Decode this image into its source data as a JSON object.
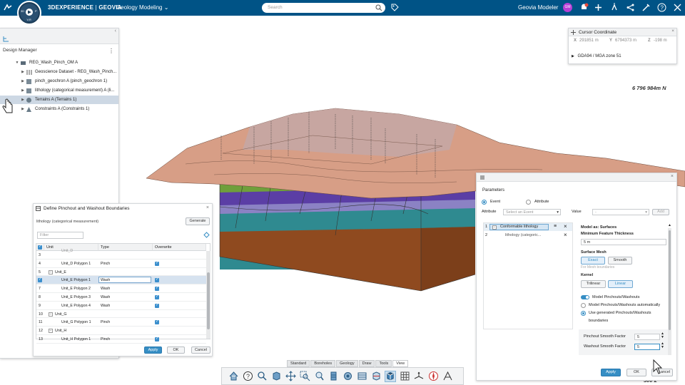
{
  "topbar": {
    "brand": "3DEXPERIENCE",
    "separator": " | ",
    "brand_suffix": "GEOVIA",
    "app_name": "Geology Modeling",
    "search_placeholder": "Search",
    "user_name": "Geovia Modeler",
    "avatar_initials": "GM",
    "compass_version": "V.R",
    "compass_letters": [
      "3D",
      "P"
    ]
  },
  "design_manager": {
    "title": "Design Manager",
    "tree": [
      {
        "label": "REG_Wash_Pinch_OM A",
        "level": 1,
        "expanded": true
      },
      {
        "label": "Geoscience Dataset - REG_Wash_Pinch...",
        "level": 2
      },
      {
        "label": "pinch_geochron A (pinch_geochron 1)",
        "level": 2
      },
      {
        "label": "lithology (categorical measurement) A (li...",
        "level": 2
      },
      {
        "label": "Terrains A (Terrains 1)",
        "level": 2,
        "selected": true
      },
      {
        "label": "Constraints A (Constraints 1)",
        "level": 2
      }
    ]
  },
  "viewport": {
    "coord_north": "6 796 984m N",
    "coord_bottom": "300 2"
  },
  "cursor_coordinate": {
    "title": "Cursor Coordinate",
    "x_label": "X",
    "x_value": "291851 m",
    "y_label": "Y",
    "y_value": "6794373 m",
    "z_label": "Z",
    "z_value": "-198 m",
    "crs": "GDA94 / MGA zone 51"
  },
  "pinchout_dialog": {
    "title": "Define Pinchout and Washout Boundaries",
    "source": "lithology (categorical measurement)",
    "generate_label": "Generate",
    "filter_placeholder": "Filter",
    "columns": [
      "Unit",
      "Type",
      "Overwrite"
    ],
    "rows": [
      {
        "num": "3",
        "unit": "Unit_D",
        "type": "",
        "overwrite": null,
        "group": false
      },
      {
        "num": "4",
        "unit": "Unit_D Polygon 1",
        "type": "Pinch",
        "overwrite": true,
        "group": false
      },
      {
        "num": "5",
        "unit": "Unit_E",
        "type": "",
        "overwrite": null,
        "group": true
      },
      {
        "num": "6",
        "unit": "Unit_E Polygon 1",
        "type": "Wash",
        "overwrite": true,
        "group": false,
        "selected": true,
        "checked": true
      },
      {
        "num": "7",
        "unit": "Unit_E Polygon 2",
        "type": "Wash",
        "overwrite": true,
        "group": false
      },
      {
        "num": "8",
        "unit": "Unit_E Polygon 3",
        "type": "Wash",
        "overwrite": true,
        "group": false
      },
      {
        "num": "9",
        "unit": "Unit_E Polygon 4",
        "type": "Wash",
        "overwrite": true,
        "group": false
      },
      {
        "num": "10",
        "unit": "Unit_G",
        "type": "",
        "overwrite": null,
        "group": true
      },
      {
        "num": "11",
        "unit": "Unit_G Polygon 1",
        "type": "Pinch",
        "overwrite": true,
        "group": false
      },
      {
        "num": "12",
        "unit": "Unit_H",
        "type": "",
        "overwrite": null,
        "group": true
      },
      {
        "num": "13",
        "unit": "Unit_H Polygon 1",
        "type": "Pinch",
        "overwrite": true,
        "group": false
      }
    ],
    "apply_label": "Apply",
    "ok_label": "OK",
    "cancel_label": "Cancel"
  },
  "parameters": {
    "title": "Parameters",
    "option_event": "Event",
    "option_attribute": "Attribute",
    "attribute_label": "Attribute",
    "attribute_placeholder": "Select an Event",
    "value_label": "Value",
    "value_placeholder": "-",
    "add_label": "Add",
    "events": [
      {
        "num": "1",
        "label": "Conformable lithology"
      },
      {
        "num": "2",
        "label": "lithology (categoric..."
      }
    ],
    "model_as": "Model as: Surfaces",
    "min_thickness_label": "Minimum Feature Thickness",
    "min_thickness_value": "5 m",
    "surface_mesh_label": "Surface Mesh",
    "mesh_exact": "Exact",
    "mesh_smooth": "Smooth",
    "mesh_hint": "For Mesh boundaries",
    "kernel_label": "Kernel",
    "kernel_trilinear": "Trilinear",
    "kernel_linear": "Linear",
    "model_pinch": "Model Pinchouts/Washouts",
    "model_pinch_auto": "Model Pinchouts/Washouts automatically",
    "use_generated": "Use generated Pinchouts/Washouts",
    "use_generated_2": "boundaries",
    "pinchout_factor_label": "Pinchout Smooth Factor",
    "pinchout_factor_value": "5",
    "washout_factor_label": "Washout Smooth Factor",
    "washout_factor_value": "5",
    "apply_label": "Apply",
    "ok_label": "OK",
    "cancel_label": "ancel"
  },
  "bottom_tabs": [
    "Standard",
    "Boreholes",
    "Geology",
    "Draw",
    "Tools",
    "View"
  ],
  "active_tab": "View",
  "colors": {
    "topbar": "#005386",
    "accent": "#368ec4",
    "terrain": "#d79e86",
    "layer_green": "#6f9f3b",
    "layer_purple": "#5b3ea5",
    "layer_teal": "#2f8a90",
    "layer_brown": "#8f4a1f"
  }
}
